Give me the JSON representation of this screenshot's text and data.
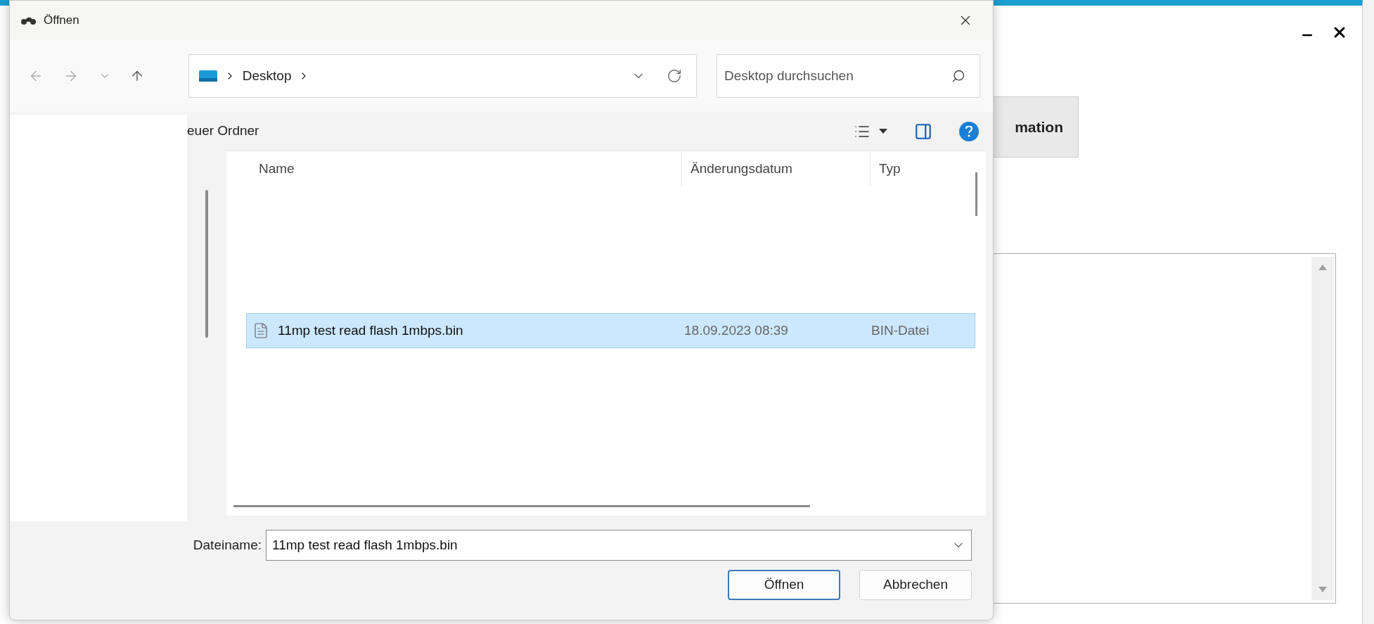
{
  "app": {
    "button": "mation"
  },
  "dialog": {
    "title": "Öffnen",
    "address": {
      "path": [
        "Desktop"
      ]
    },
    "search": {
      "placeholder": "Desktop durchsuchen"
    },
    "toolbar": {
      "new_folder": "euer Ordner"
    },
    "columns": [
      "Name",
      "Änderungsdatum",
      "Typ"
    ],
    "files": [
      {
        "name": "11mp test read flash 1mbps.bin",
        "date": "18.09.2023 08:39",
        "type": "BIN-Datei",
        "selected": true
      }
    ],
    "filename": {
      "label": "Dateiname:",
      "value": "11mp test read flash 1mbps.bin"
    },
    "buttons": [
      {
        "label": "Öffnen",
        "default": true
      },
      {
        "label": "Abbrechen",
        "default": false
      }
    ]
  }
}
